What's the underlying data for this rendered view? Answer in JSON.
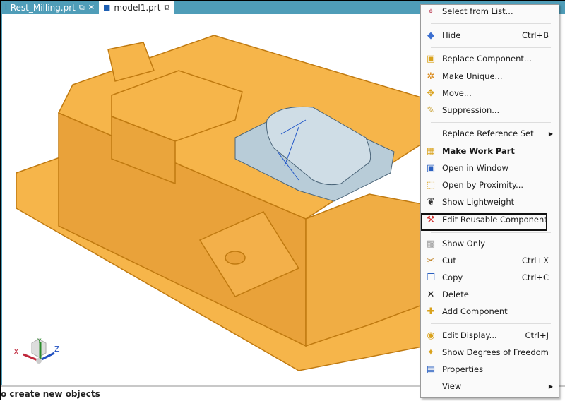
{
  "tabs": [
    {
      "label": "Rest_Milling.prt",
      "icon": "milling-operation-icon",
      "active": true
    },
    {
      "label": "model1.prt",
      "icon": "part-cube-icon",
      "active": false
    }
  ],
  "status_text": "o create new objects",
  "triad": {
    "x": "X",
    "y": "Y",
    "z": "Z"
  },
  "colors": {
    "tab_bar": "#4f9db8",
    "part_orange": "#f6b54a",
    "part_edge": "#c07a10",
    "selected_component": "#b8ccd8",
    "highlight_box": "#111111"
  },
  "menu": {
    "items": [
      {
        "label": "Select from List...",
        "icon": "crosshair-icon",
        "shortcut": ""
      },
      {
        "label": "Hide",
        "icon": "hide-icon",
        "shortcut": "Ctrl+B"
      },
      {
        "label": "Replace Component...",
        "icon": "replace-component-icon",
        "shortcut": ""
      },
      {
        "label": "Make Unique...",
        "icon": "make-unique-icon",
        "shortcut": ""
      },
      {
        "label": "Move...",
        "icon": "move-icon",
        "shortcut": ""
      },
      {
        "label": "Suppression...",
        "icon": "suppression-icon",
        "shortcut": ""
      },
      {
        "label": "Replace Reference Set",
        "icon": "",
        "shortcut": "",
        "submenu": true
      },
      {
        "label": "Make Work Part",
        "icon": "work-part-icon",
        "shortcut": "",
        "bold": true
      },
      {
        "label": "Open in Window",
        "icon": "open-window-icon",
        "shortcut": ""
      },
      {
        "label": "Open by Proximity...",
        "icon": "proximity-icon",
        "shortcut": ""
      },
      {
        "label": "Show Lightweight",
        "icon": "lightweight-icon",
        "shortcut": ""
      },
      {
        "label": "Edit Reusable Component",
        "icon": "reusable-component-icon",
        "shortcut": "",
        "highlighted": true
      },
      {
        "label": "Show Only",
        "icon": "show-only-icon",
        "shortcut": ""
      },
      {
        "label": "Cut",
        "icon": "scissors-icon",
        "shortcut": "Ctrl+X"
      },
      {
        "label": "Copy",
        "icon": "copy-icon",
        "shortcut": "Ctrl+C"
      },
      {
        "label": "Delete",
        "icon": "delete-x-icon",
        "shortcut": ""
      },
      {
        "label": "Add Component",
        "icon": "add-component-icon",
        "shortcut": ""
      },
      {
        "label": "Edit Display...",
        "icon": "edit-display-icon",
        "shortcut": "Ctrl+J"
      },
      {
        "label": "Show Degrees of Freedom",
        "icon": "degrees-of-freedom-icon",
        "shortcut": ""
      },
      {
        "label": "Properties",
        "icon": "properties-icon",
        "shortcut": ""
      },
      {
        "label": "View",
        "icon": "",
        "shortcut": "",
        "submenu": true
      }
    ]
  }
}
